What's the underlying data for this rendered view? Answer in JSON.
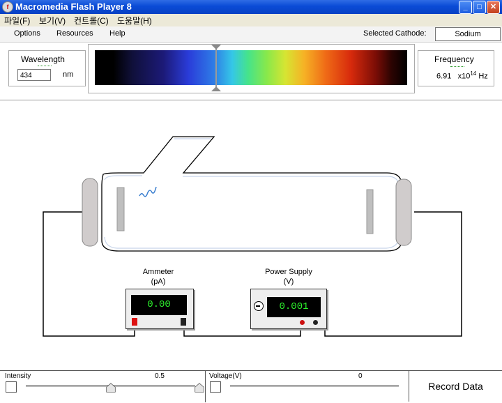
{
  "window": {
    "title": "Macromedia Flash Player 8",
    "minimize": "_",
    "maximize": "□",
    "close": "✕"
  },
  "menubar": {
    "items": [
      "파일(F)",
      "보기(V)",
      "컨트롤(C)",
      "도움말(H)"
    ]
  },
  "toolbar": {
    "options": "Options",
    "resources": "Resources",
    "help": "Help",
    "cathode_label": "Selected Cathode:",
    "cathode_value": "Sodium"
  },
  "wavelength": {
    "title": "Wavelength",
    "value": "434",
    "unit": "nm"
  },
  "frequency": {
    "title": "Frequency",
    "mantissa": "6.91",
    "exponent_base": "x10",
    "exponent": "14",
    "unit": "Hz"
  },
  "ammeter": {
    "title": "Ammeter",
    "unit": "(pA)",
    "reading": "0.00"
  },
  "power_supply": {
    "title": "Power Supply",
    "unit": "(V)",
    "reading": "0.001"
  },
  "controls": {
    "intensity": {
      "label": "Intensity",
      "value": "0.5",
      "level": 0.5
    },
    "voltage": {
      "label": "Voltage(V)",
      "value": "0",
      "level": 0.0
    },
    "record": "Record Data"
  },
  "colors": {
    "lcd_text": "#2cf02c",
    "title_bar": "#0a4bd6",
    "photon": "#3a7fd0"
  }
}
